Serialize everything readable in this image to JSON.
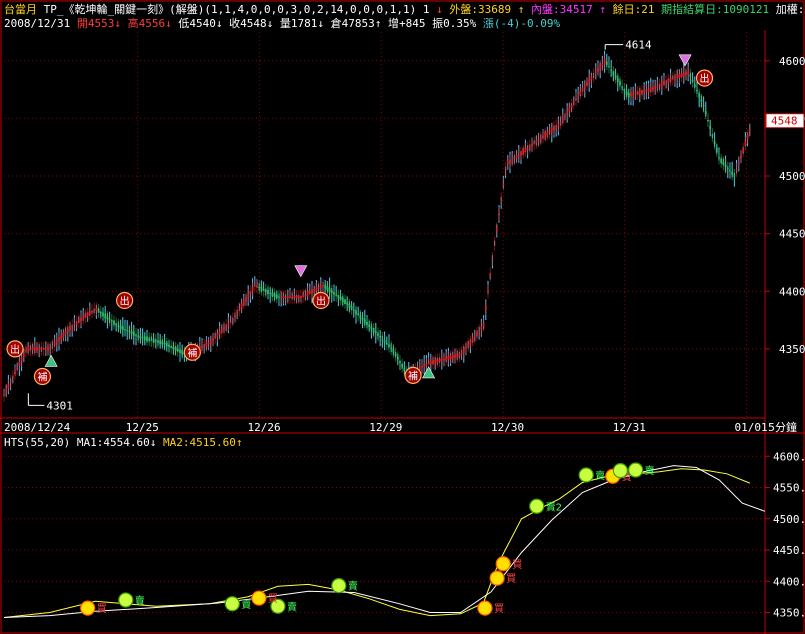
{
  "header": {
    "symbol": "台當月",
    "strategy": "TP_《乾坤輪_關鍵一刻》(解盤)(1,1,4,0,0,0,3,0,2,14,0,0,0,1,1) 1",
    "down_arrow": "↓",
    "outside_label": "外盤:33689",
    "up_arrow1": "↑",
    "inside_label": "內盤:34517",
    "up_arrow2": "↑",
    "days_left": "餘日:21",
    "settlement": "期指結算日:1090121",
    "weight_label": "加權:"
  },
  "quote": {
    "date": "2008/12/31",
    "open": "開4553",
    "open_arrow": "↓",
    "high": "高4556",
    "high_arrow": "↓",
    "low": "低4540",
    "low_arrow": "↓",
    "close": "收4548",
    "close_arrow": "↓",
    "volume": "量1781",
    "volume_arrow": "↓",
    "oi": "倉47853",
    "oi_arrow": "↑",
    "change_oi": "增+845",
    "amplitude": "振0.35%",
    "change": "漲(-4)-0.09%"
  },
  "indicator_header": {
    "name": "HTS(55,20)",
    "ma1": "MA1:4554.60",
    "ma1_arrow": "↓",
    "ma2": "MA2:4515.60",
    "ma2_arrow": "↑"
  },
  "timeframe": "5分鐘",
  "colors": {
    "background": "#000000",
    "frame": "#c80000",
    "grid": "#8a0000",
    "up_candle": "#e02020",
    "down_candle": "#30c060",
    "wick": "#58c8ff",
    "ma1": "#ffff40",
    "ma2": "#ffffff",
    "signal_out": "#ffb020",
    "signal_fill": "#ffd000",
    "text_axis": "#ffffff"
  },
  "chart_data": [
    {
      "type": "candlestick",
      "title": "",
      "x_labels": [
        "2008/12/24",
        "12/25",
        "12/26",
        "12/29",
        "12/30",
        "12/31",
        "01/01"
      ],
      "y_ticks": [
        4350,
        4400,
        4450,
        4500,
        4550,
        4600
      ],
      "ylim": [
        4290,
        4625
      ],
      "last_price": 4548,
      "grid": true,
      "annotations": [
        {
          "label": "4301",
          "kind": "low"
        },
        {
          "label": "4614",
          "kind": "high"
        }
      ],
      "signals": [
        {
          "text": "出",
          "x": 0.004,
          "price": 4350
        },
        {
          "text": "補",
          "x": 0.04,
          "price": 4326
        },
        {
          "text": "出",
          "x": 0.148,
          "price": 4392
        },
        {
          "text": "補",
          "x": 0.237,
          "price": 4347
        },
        {
          "text": "出",
          "x": 0.406,
          "price": 4392
        },
        {
          "text": "補",
          "x": 0.527,
          "price": 4327
        },
        {
          "text": "出",
          "x": 0.91,
          "price": 4585
        }
      ],
      "markers": [
        {
          "type": "triangle-up",
          "x": 0.062,
          "price": 4340
        },
        {
          "type": "triangle-down",
          "x": 0.39,
          "price": 4417
        },
        {
          "type": "triangle-up",
          "x": 0.558,
          "price": 4330
        },
        {
          "type": "triangle-down",
          "x": 0.895,
          "price": 4600
        }
      ],
      "series": [
        {
          "x": [
            0,
            0.03,
            0.06,
            0.09,
            0.12,
            0.15,
            0.18,
            0.21,
            0.24,
            0.27,
            0.3,
            0.33,
            0.36,
            0.39,
            0.42,
            0.45,
            0.48,
            0.51,
            0.53,
            0.56,
            0.6,
            0.63,
            0.64,
            0.66,
            0.7,
            0.73,
            0.76,
            0.79,
            0.82,
            0.85,
            0.88,
            0.9,
            0.92,
            0.94,
            0.96,
            0.98
          ],
          "values": [
            4310,
            4350,
            4350,
            4370,
            4385,
            4370,
            4360,
            4355,
            4345,
            4355,
            4375,
            4405,
            4395,
            4395,
            4405,
            4390,
            4370,
            4350,
            4328,
            4338,
            4345,
            4370,
            4420,
            4510,
            4530,
            4545,
            4575,
            4600,
            4570,
            4575,
            4585,
            4590,
            4560,
            4515,
            4500,
            4540
          ]
        }
      ]
    },
    {
      "type": "line",
      "title": "",
      "y_ticks": [
        4350,
        4400,
        4450,
        4500,
        4550,
        4600
      ],
      "ylim": [
        4330,
        4610
      ],
      "series": [
        {
          "name": "MA1",
          "x": [
            0,
            0.06,
            0.12,
            0.15,
            0.2,
            0.27,
            0.32,
            0.36,
            0.4,
            0.44,
            0.48,
            0.52,
            0.56,
            0.6,
            0.63,
            0.65,
            0.68,
            0.71,
            0.73,
            0.76,
            0.8,
            0.83,
            0.86,
            0.89,
            0.92,
            0.95,
            0.98
          ],
          "values": [
            4342,
            4350,
            4368,
            4365,
            4360,
            4364,
            4375,
            4392,
            4395,
            4386,
            4372,
            4355,
            4345,
            4348,
            4365,
            4430,
            4500,
            4520,
            4532,
            4558,
            4570,
            4572,
            4575,
            4580,
            4578,
            4572,
            4557
          ]
        },
        {
          "name": "MA2",
          "x": [
            0,
            0.06,
            0.12,
            0.2,
            0.28,
            0.34,
            0.4,
            0.46,
            0.52,
            0.56,
            0.6,
            0.64,
            0.68,
            0.72,
            0.76,
            0.8,
            0.84,
            0.88,
            0.91,
            0.94,
            0.97,
            1.0
          ],
          "values": [
            4342,
            4345,
            4352,
            4358,
            4365,
            4374,
            4384,
            4382,
            4364,
            4350,
            4350,
            4383,
            4446,
            4498,
            4542,
            4562,
            4575,
            4585,
            4582,
            4562,
            4525,
            4512
          ]
        }
      ],
      "signals": [
        {
          "text": "賣",
          "x": 0.16,
          "value": 4370
        },
        {
          "text": "買",
          "x": 0.11,
          "value": 4357
        },
        {
          "text": "賣",
          "x": 0.36,
          "value": 4360
        },
        {
          "text": "買",
          "x": 0.335,
          "value": 4373
        },
        {
          "text": "賣",
          "x": 0.3,
          "value": 4364
        },
        {
          "text": "賣",
          "x": 0.44,
          "value": 4393
        },
        {
          "text": "買",
          "x": 0.632,
          "value": 4357
        },
        {
          "text": "買",
          "x": 0.648,
          "value": 4405
        },
        {
          "text": "買",
          "x": 0.656,
          "value": 4428
        },
        {
          "text": "賣2",
          "x": 0.7,
          "value": 4520
        },
        {
          "text": "賣",
          "x": 0.765,
          "value": 4570
        },
        {
          "text": "買",
          "x": 0.8,
          "value": 4568
        },
        {
          "text": "賣",
          "x": 0.81,
          "value": 4577
        },
        {
          "text": "賣",
          "x": 0.83,
          "value": 4578
        }
      ]
    }
  ]
}
